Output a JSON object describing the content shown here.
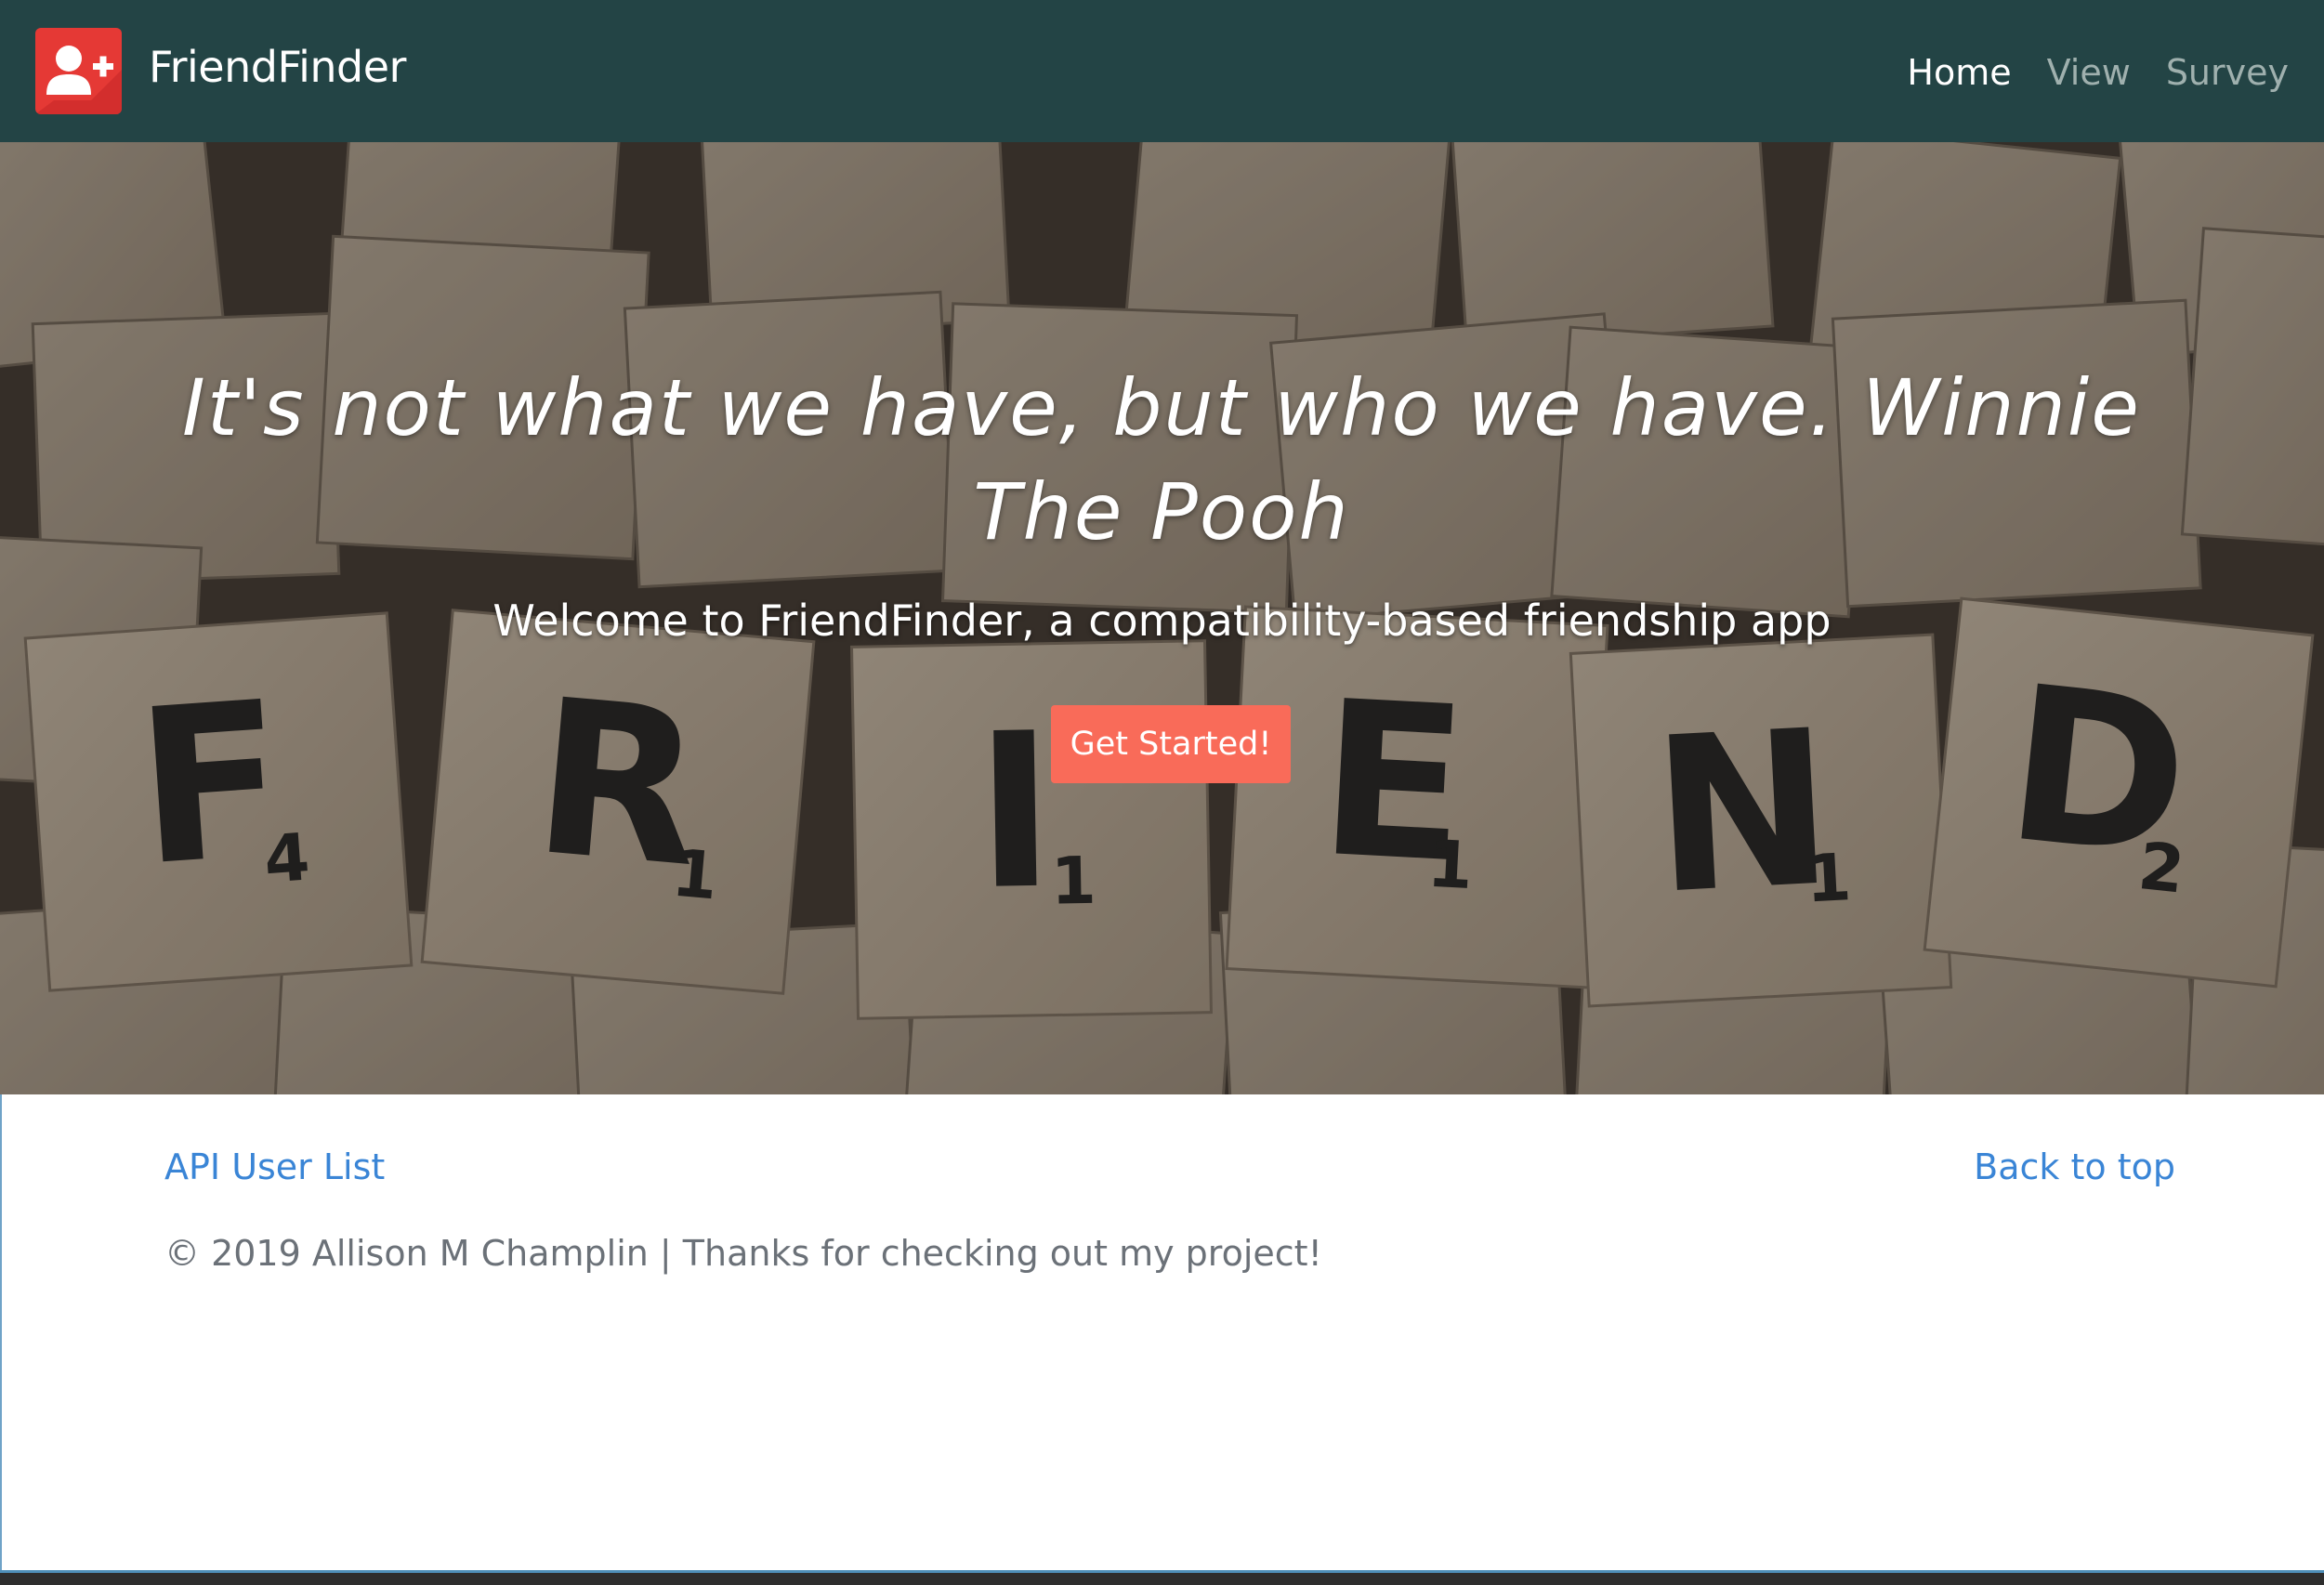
{
  "navbar": {
    "brand_name": "FriendFinder",
    "logo_icon": "add-user-icon",
    "links": [
      {
        "label": "Home",
        "active": true
      },
      {
        "label": "View",
        "active": false
      },
      {
        "label": "Survey",
        "active": false
      }
    ]
  },
  "hero": {
    "quote": "It's not what we have, but who we have. Winnie The Pooh",
    "subtitle": "Welcome to FriendFinder, a compatibility-based friendship app",
    "cta_label": "Get Started!",
    "tiles": [
      {
        "letter": "F",
        "score": "4"
      },
      {
        "letter": "R",
        "score": "1"
      },
      {
        "letter": "I",
        "score": "1"
      },
      {
        "letter": "E",
        "score": "1"
      },
      {
        "letter": "N",
        "score": "1"
      },
      {
        "letter": "D",
        "score": "2"
      }
    ]
  },
  "footer": {
    "api_link": "API User List",
    "back_to_top": "Back to top",
    "copyright": "© 2019 Allison M Champlin | Thanks for checking out my project!"
  },
  "colors": {
    "navbar_bg": "#234445",
    "cta_bg": "#f96b59",
    "link": "#3a85d6",
    "logo_bg": "#e53935"
  }
}
